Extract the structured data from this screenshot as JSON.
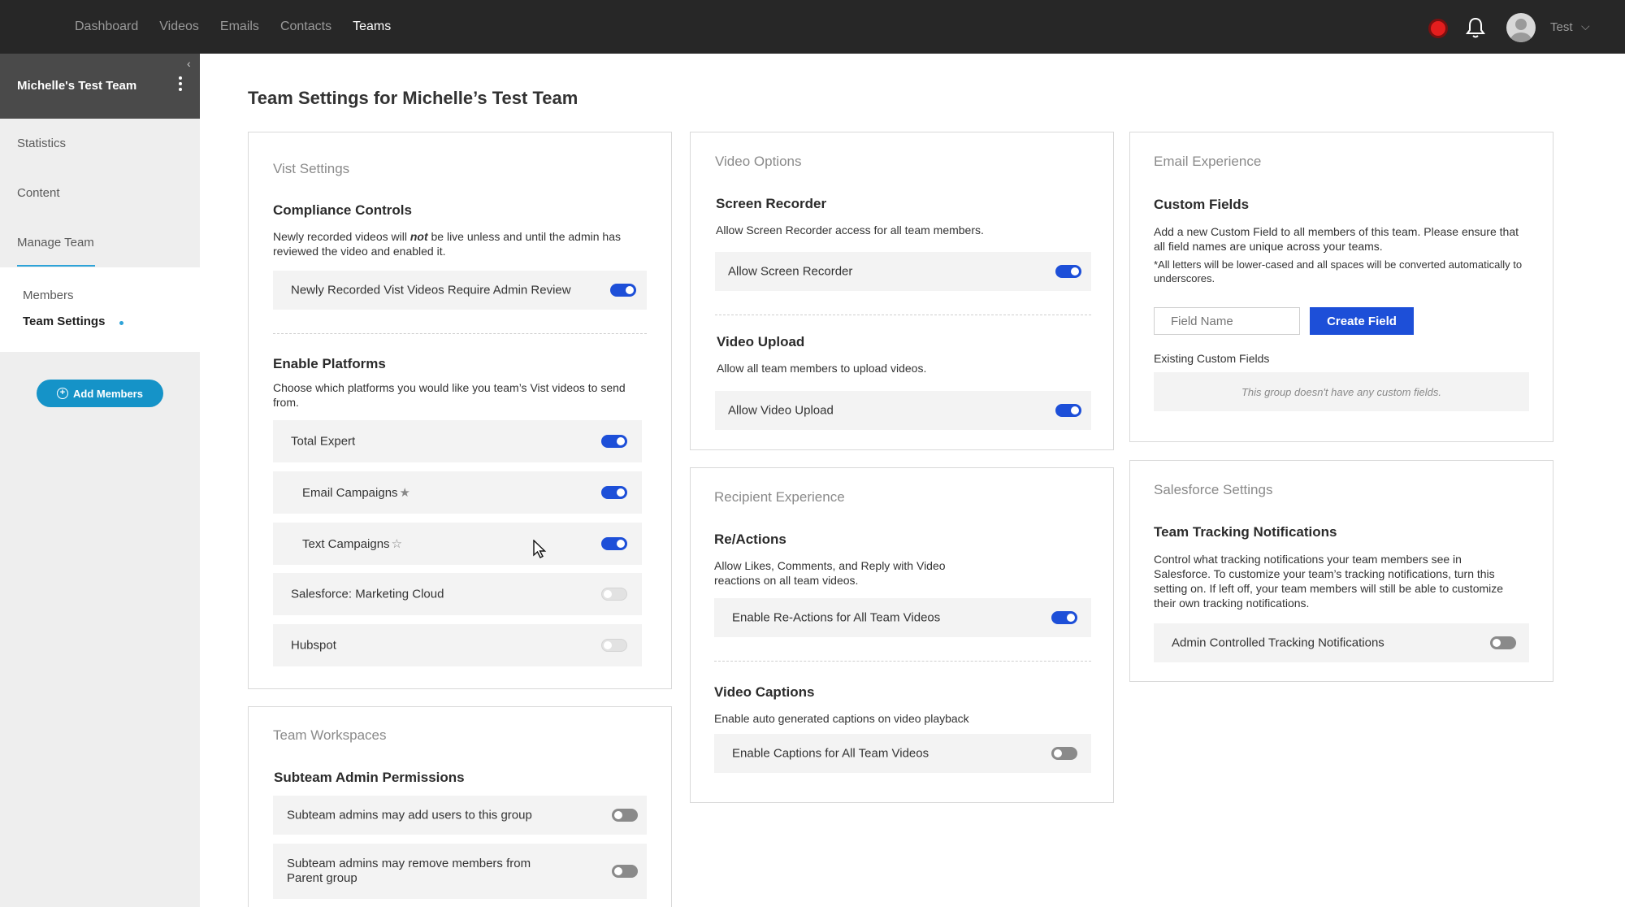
{
  "topnav": {
    "items": [
      "Dashboard",
      "Videos",
      "Emails",
      "Contacts",
      "Teams"
    ],
    "active": "Teams",
    "user_name": "Test",
    "icons": [
      "record-icon",
      "bell-icon",
      "avatar",
      "chevron-down-icon"
    ]
  },
  "sidebar": {
    "team_name": "Michelle's Test Team",
    "links": [
      "Statistics",
      "Content",
      "Manage Team"
    ],
    "sub_links": [
      "Members",
      "Team Settings"
    ],
    "add_members_label": "Add Members"
  },
  "page_title": "Team Settings for Michelle’s Test Team",
  "vist_settings": {
    "card_title": "Vist Settings",
    "compliance_title": "Compliance Controls",
    "compliance_desc_1": "Newly recorded videos will ",
    "compliance_desc_em": "not",
    "compliance_desc_2": " be live unless and until the admin has reviewed the video and enabled it.",
    "admin_review_label": "Newly Recorded Vist Videos Require Admin Review",
    "admin_review_on": true,
    "platforms_title": "Enable Platforms",
    "platforms_desc": "Choose which platforms you would like you team’s Vist videos to send from.",
    "platforms": [
      {
        "label": "Total Expert",
        "state": "on"
      },
      {
        "label": "Email Campaigns",
        "state": "on"
      },
      {
        "label": "Text Campaigns",
        "state": "on"
      },
      {
        "label": "Salesforce: Marketing Cloud",
        "state": "disabled"
      },
      {
        "label": "Hubspot",
        "state": "disabled"
      }
    ]
  },
  "team_workspaces": {
    "card_title": "Team Workspaces",
    "section_title": "Subteam Admin Permissions",
    "rows": [
      {
        "label": "Subteam admins may add users to this group",
        "state": "off"
      },
      {
        "label": "Subteam admins may remove members from Parent group",
        "state": "off"
      }
    ]
  },
  "video_options": {
    "card_title": "Video Options",
    "screen_title": "Screen Recorder",
    "screen_desc": "Allow Screen Recorder access for all team members.",
    "screen_label": "Allow Screen Recorder",
    "upload_title": "Video Upload",
    "upload_desc": "Allow all team members to upload videos.",
    "upload_label": "Allow Video Upload"
  },
  "recipient": {
    "card_title": "Recipient Experience",
    "reactions_title": "Re/Actions",
    "reactions_desc": "Allow Likes, Comments, and Reply with Video reactions on all team videos.",
    "reactions_label": "Enable Re-Actions for All Team Videos",
    "captions_title": "Video Captions",
    "captions_desc": "Enable auto generated captions on video playback",
    "captions_label": "Enable Captions for All Team Videos"
  },
  "email_experience": {
    "card_title": "Email Experience",
    "custom_title": "Custom Fields",
    "custom_desc": "Add a new Custom Field to all members of this team. Please ensure that all field names are unique across your teams.",
    "custom_note": "*All letters will be lower-cased and all spaces will be converted automatically to underscores.",
    "field_placeholder": "Field Name",
    "create_label": "Create Field",
    "existing_label": "Existing Custom Fields",
    "empty_text": "This group doesn't have any custom fields."
  },
  "salesforce": {
    "card_title": "Salesforce Settings",
    "tracking_title": "Team Tracking Notifications",
    "tracking_desc": "Control what tracking notifications your team members see in Salesforce. To customize your team’s tracking notifications, turn this setting on. If left off, your team members will still be able to customize their own tracking notifications.",
    "tracking_label": "Admin Controlled Tracking Notifications"
  },
  "colors": {
    "accent": "#1d4fd8",
    "sidebar_button": "#1593c8",
    "topbar": "#272727",
    "record": "#e41e1e"
  }
}
